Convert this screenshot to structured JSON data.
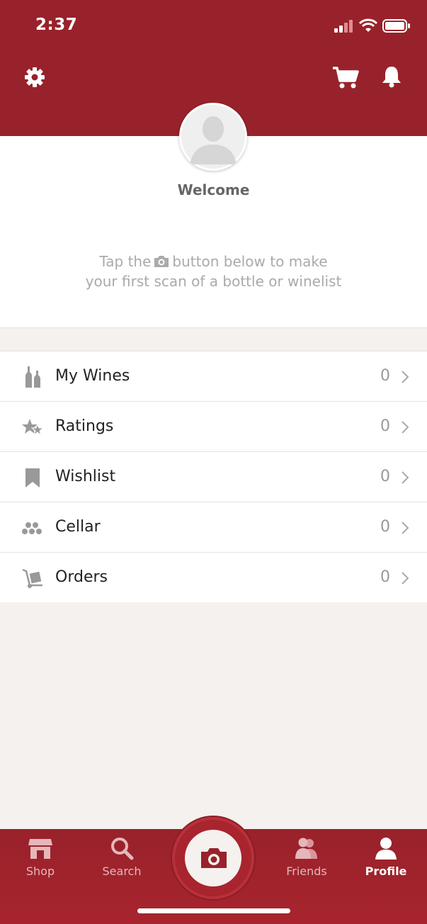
{
  "status_bar": {
    "time": "2:37"
  },
  "header": {
    "settings_icon": "gear-icon",
    "cart_icon": "cart-icon",
    "notifications_icon": "bell-icon"
  },
  "profile": {
    "welcome": "Welcome",
    "hint_before": "Tap the",
    "hint_after": "button below to make",
    "hint_line2": "your first scan of a bottle or winelist"
  },
  "menu": {
    "items": [
      {
        "label": "My Wines",
        "count": "0",
        "icon": "bottles-icon"
      },
      {
        "label": "Ratings",
        "count": "0",
        "icon": "stars-icon"
      },
      {
        "label": "Wishlist",
        "count": "0",
        "icon": "bookmark-icon"
      },
      {
        "label": "Cellar",
        "count": "0",
        "icon": "cellar-icon"
      },
      {
        "label": "Orders",
        "count": "0",
        "icon": "hand-truck-icon"
      }
    ]
  },
  "tabbar": {
    "tabs": [
      {
        "label": "Shop",
        "icon": "shop-icon"
      },
      {
        "label": "Search",
        "icon": "search-icon"
      },
      {
        "label": "Friends",
        "icon": "friends-icon"
      },
      {
        "label": "Profile",
        "icon": "profile-icon"
      }
    ],
    "active": "Profile"
  },
  "colors": {
    "brand": "#98222b",
    "background": "#f4f1ee",
    "muted_text": "#999999"
  }
}
